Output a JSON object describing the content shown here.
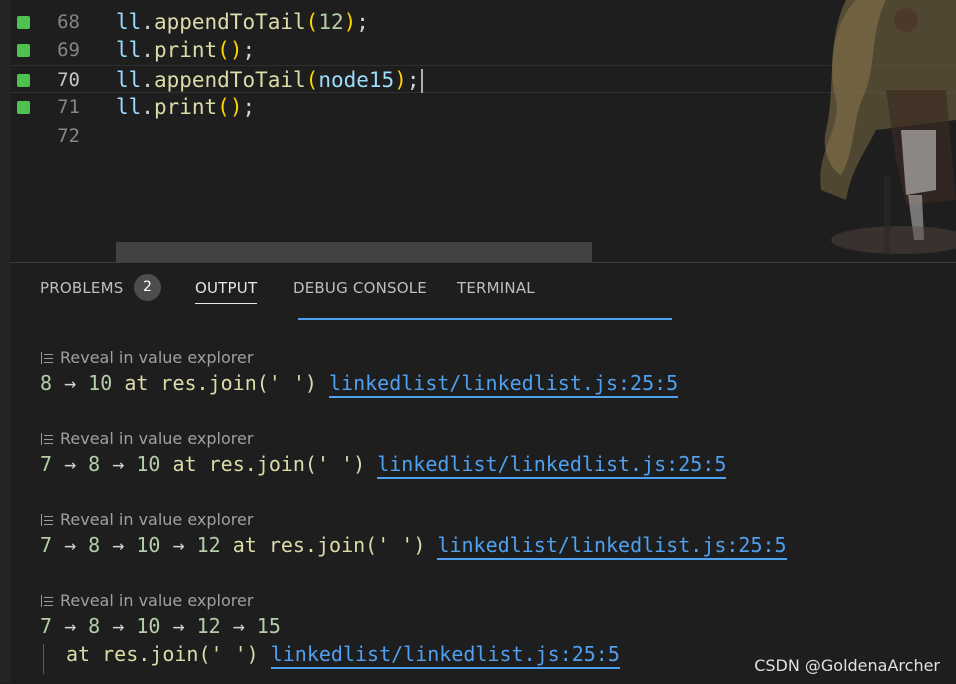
{
  "editor": {
    "lines": [
      {
        "number": "68",
        "text": "ll.appendToTail(12);"
      },
      {
        "number": "69",
        "text": "ll.print();"
      },
      {
        "number": "70",
        "text": "ll.appendToTail(node15);"
      },
      {
        "number": "71",
        "text": "ll.print();"
      },
      {
        "number": "72",
        "text": ""
      }
    ]
  },
  "panel": {
    "tabs": [
      {
        "label": "PROBLEMS",
        "badge": "2"
      },
      {
        "label": "OUTPUT"
      },
      {
        "label": "DEBUG CONSOLE"
      },
      {
        "label": "TERMINAL"
      }
    ],
    "active_tab": "OUTPUT"
  },
  "output": {
    "reveal_label": "Reveal in value explorer",
    "link": "linkedlist/linkedlist.js:25:5",
    "entries": [
      {
        "values": [
          "8",
          "10"
        ],
        "expr": "at res.join(' ')"
      },
      {
        "values": [
          "7",
          "8",
          "10"
        ],
        "expr": "at res.join(' ')"
      },
      {
        "values": [
          "7",
          "8",
          "10",
          "12"
        ],
        "expr": "at res.join(' ')"
      },
      {
        "values": [
          "7",
          "8",
          "10",
          "12",
          "15"
        ],
        "expr": "at res.join(' ')"
      }
    ]
  },
  "watermark": "CSDN @GoldenaArcher",
  "colors": {
    "accent_link": "#4fa0f0",
    "gutter_modified": "#4ec24f"
  }
}
